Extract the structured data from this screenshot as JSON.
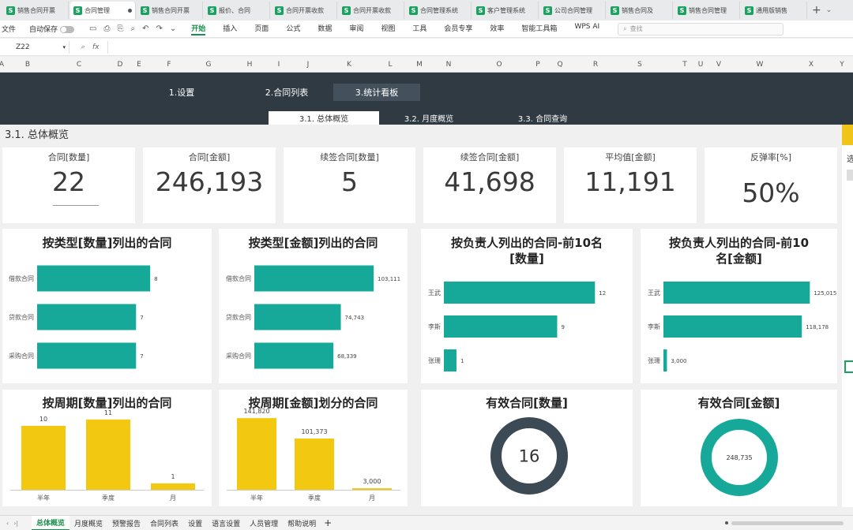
{
  "tabs": [
    {
      "label": "销售合同开票",
      "active": false
    },
    {
      "label": "合同管理",
      "active": true
    },
    {
      "label": "销售合同开票",
      "active": false
    },
    {
      "label": "报价、合同",
      "active": false
    },
    {
      "label": "合同开票收款",
      "active": false
    },
    {
      "label": "合同开票收款",
      "active": false
    },
    {
      "label": "合同管理系统",
      "active": false
    },
    {
      "label": "客户管理系统",
      "active": false
    },
    {
      "label": "公司合同管理",
      "active": false
    },
    {
      "label": "销售合同及",
      "active": false
    },
    {
      "label": "销售合同管理",
      "active": false
    },
    {
      "label": "通用版销售",
      "active": false
    }
  ],
  "tab_icon_letter": "S",
  "tab_plus": "+",
  "tab_chevron": "⌄",
  "ribbon": {
    "file": "文件",
    "autosave": "自动保存",
    "menus": [
      "开始",
      "插入",
      "页面",
      "公式",
      "数据",
      "审阅",
      "视图",
      "工具",
      "会员专享",
      "效率",
      "智能工具箱",
      "WPS AI"
    ],
    "active_menu": "开始",
    "search_placeholder": "查找"
  },
  "namebox": "Z22",
  "fx": "fx",
  "columns": [
    "A",
    "B",
    "C",
    "D",
    "E",
    "F",
    "G",
    "H",
    "I",
    "J",
    "K",
    "L",
    "M",
    "N",
    "O",
    "P",
    "Q",
    "R",
    "S",
    "T",
    "U",
    "V",
    "W",
    "X",
    "Y"
  ],
  "nav": [
    "1.设置",
    "2.合同列表",
    "3.统计看板"
  ],
  "nav_active": 2,
  "subnav": [
    "3.1. 总体概览",
    "3.2. 月度概览",
    "3.3. 合同查询"
  ],
  "subnav_active": 0,
  "section_title": "3.1. 总体概览",
  "kpis": [
    {
      "title": "合同[数量]",
      "value": "22"
    },
    {
      "title": "合同[金额]",
      "value": "246,193"
    },
    {
      "title": "续签合同[数量]",
      "value": "5"
    },
    {
      "title": "续签合同[金额]",
      "value": "41,698"
    },
    {
      "title": "平均值[金额]",
      "value": "11,191"
    },
    {
      "title": "反弹率[%]",
      "value": "50%"
    }
  ],
  "charts": {
    "type_count": {
      "title": "按类型[数量]列出的合同",
      "chart_data": {
        "type": "bar",
        "orientation": "horizontal",
        "categories": [
          "借款合同",
          "贷款合同",
          "采购合同"
        ],
        "values": [
          8,
          7,
          7
        ],
        "labels": [
          "8",
          "7",
          "7"
        ],
        "xlim": [
          0,
          9.5
        ],
        "color": "#16a99a"
      }
    },
    "type_amount": {
      "title": "按类型[金额]列出的合同",
      "chart_data": {
        "type": "bar",
        "orientation": "horizontal",
        "categories": [
          "借款合同",
          "贷款合同",
          "采购合同"
        ],
        "values": [
          103111,
          74743,
          68339
        ],
        "labels": [
          "103,111",
          "74,743",
          "68,339"
        ],
        "xlim": [
          0,
          116000
        ],
        "color": "#16a99a"
      }
    },
    "owner_count": {
      "title": "按负责人列出的合同-前10名[数量]",
      "title_lines": [
        "按负责人列出的合同-前10名",
        "[数量]"
      ],
      "chart_data": {
        "type": "bar",
        "orientation": "horizontal",
        "categories": [
          "王武",
          "李斯",
          "张珊"
        ],
        "values": [
          12,
          9,
          1
        ],
        "labels": [
          "12",
          "9",
          "1"
        ],
        "xlim": [
          0,
          13.3
        ],
        "color": "#16a99a"
      }
    },
    "owner_amount": {
      "title": "按负责人列出的合同-前10名[金额]",
      "title_lines": [
        "按负责人列出的合同-前10",
        "名[金额]"
      ],
      "chart_data": {
        "type": "bar",
        "orientation": "horizontal",
        "categories": [
          "王武",
          "李斯",
          "张珊"
        ],
        "values": [
          125015,
          118178,
          3000
        ],
        "labels": [
          "125,015",
          "118,178",
          "3,000"
        ],
        "xlim": [
          0,
          143000
        ],
        "color": "#16a99a"
      }
    },
    "period_count": {
      "title": "按周期[数量]列出的合同",
      "chart_data": {
        "type": "bar",
        "orientation": "vertical",
        "categories": [
          "半年",
          "季度",
          "月"
        ],
        "values": [
          10,
          11,
          1
        ],
        "labels": [
          "10",
          "11",
          "1"
        ],
        "ylim": [
          0,
          13.2
        ],
        "color": "#f2c811"
      }
    },
    "period_amount": {
      "title": "按周期[金额]划分的合同",
      "chart_data": {
        "type": "bar",
        "orientation": "vertical",
        "categories": [
          "半年",
          "季度",
          "月"
        ],
        "values": [
          141820,
          101373,
          3000
        ],
        "labels": [
          "141,820",
          "101,373",
          "3,000"
        ],
        "ylim": [
          0,
          167000
        ],
        "color": "#f2c811"
      }
    },
    "valid_count": {
      "title": "有效合同[数量]",
      "chart_data": {
        "type": "pie",
        "variant": "donut",
        "values": [
          16
        ],
        "label": "16",
        "color": "#3b4a55"
      }
    },
    "valid_amount": {
      "title": "有效合同[金额]",
      "chart_data": {
        "type": "pie",
        "variant": "donut",
        "values": [
          248735
        ],
        "label": "248,735",
        "color": "#16a99a"
      }
    }
  },
  "right_edge_text": "选",
  "sheets": [
    "总体概览",
    "月度概览",
    "预警报告",
    "合同列表",
    "设置",
    "语言设置",
    "人员管理",
    "帮助说明"
  ],
  "sheet_active": 0,
  "sheet_add": "+"
}
